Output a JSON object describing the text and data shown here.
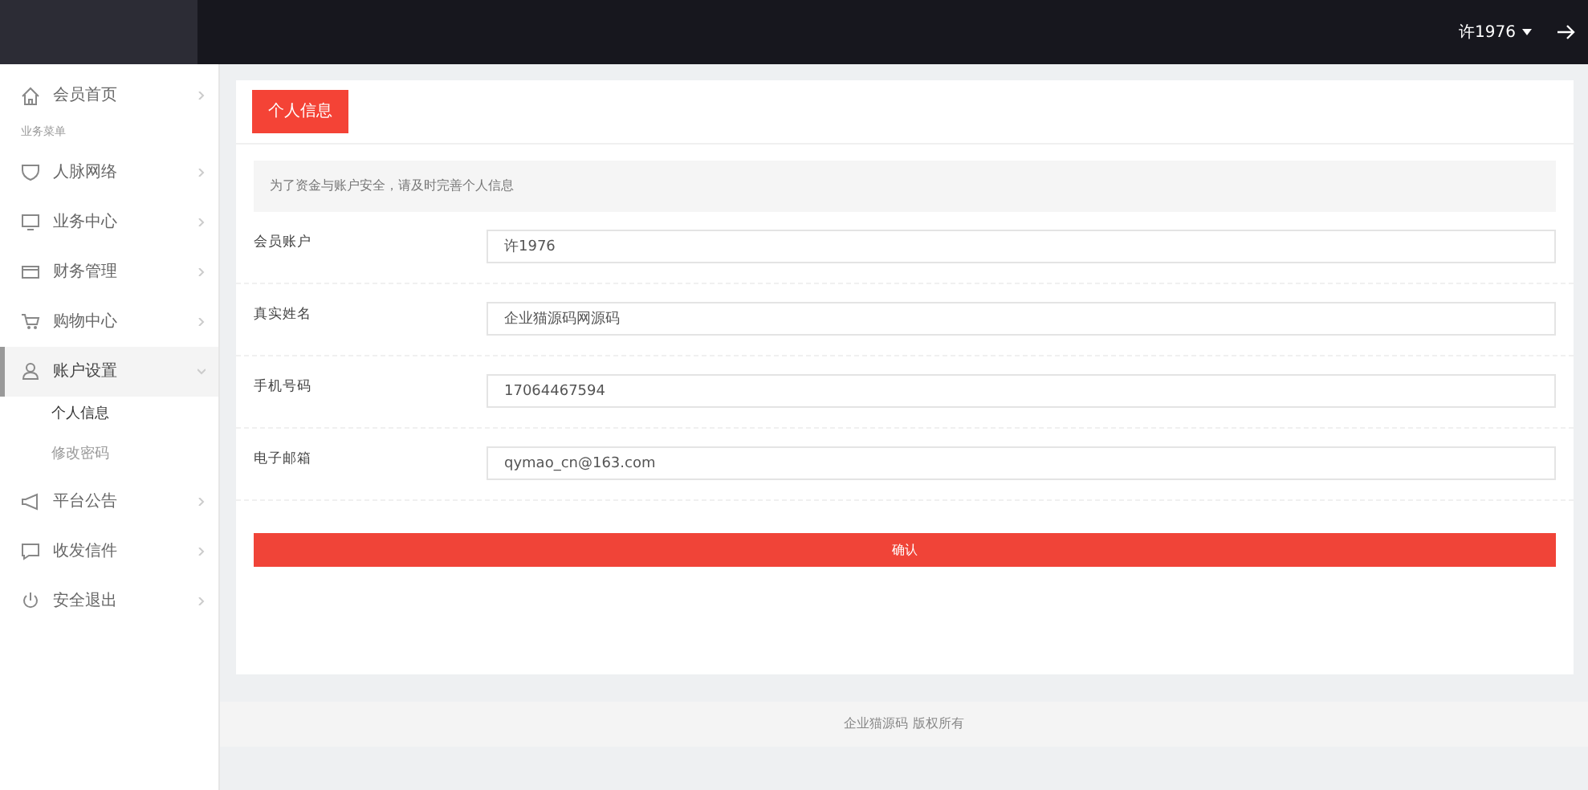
{
  "topbar": {
    "user": "许1976"
  },
  "sidebar": {
    "items": [
      {
        "kind": "link",
        "label": "会员首页",
        "selected": false,
        "expanded": false
      },
      {
        "kind": "heading",
        "label": "业务菜单"
      },
      {
        "kind": "link",
        "label": "人脉网络",
        "selected": false,
        "expanded": false
      },
      {
        "kind": "link",
        "label": "业务中心",
        "selected": false,
        "expanded": false
      },
      {
        "kind": "link",
        "label": "财务管理",
        "selected": false,
        "expanded": false
      },
      {
        "kind": "link",
        "label": "购物中心",
        "selected": false,
        "expanded": false
      },
      {
        "kind": "link",
        "label": "账户设置",
        "selected": true,
        "expanded": true,
        "children": [
          {
            "label": "个人信息",
            "selected": true
          },
          {
            "label": "修改密码",
            "selected": false
          }
        ]
      },
      {
        "kind": "link",
        "label": "平台公告",
        "selected": false,
        "expanded": false
      },
      {
        "kind": "link",
        "label": "收发信件",
        "selected": false,
        "expanded": false
      },
      {
        "kind": "link",
        "label": "安全退出",
        "selected": false,
        "expanded": false
      }
    ]
  },
  "panel": {
    "tab": "个人信息",
    "notice": "为了资金与账户安全，请及时完善个人信息",
    "fields": [
      {
        "label": "会员账户",
        "value": "许1976"
      },
      {
        "label": "真实姓名",
        "value": "企业猫源码网源码"
      },
      {
        "label": "手机号码",
        "value": "17064467594"
      },
      {
        "label": "电子邮箱",
        "value": "qymao_cn@163.com"
      }
    ],
    "submit": "确认"
  },
  "footer": "企业猫源码 版权所有"
}
